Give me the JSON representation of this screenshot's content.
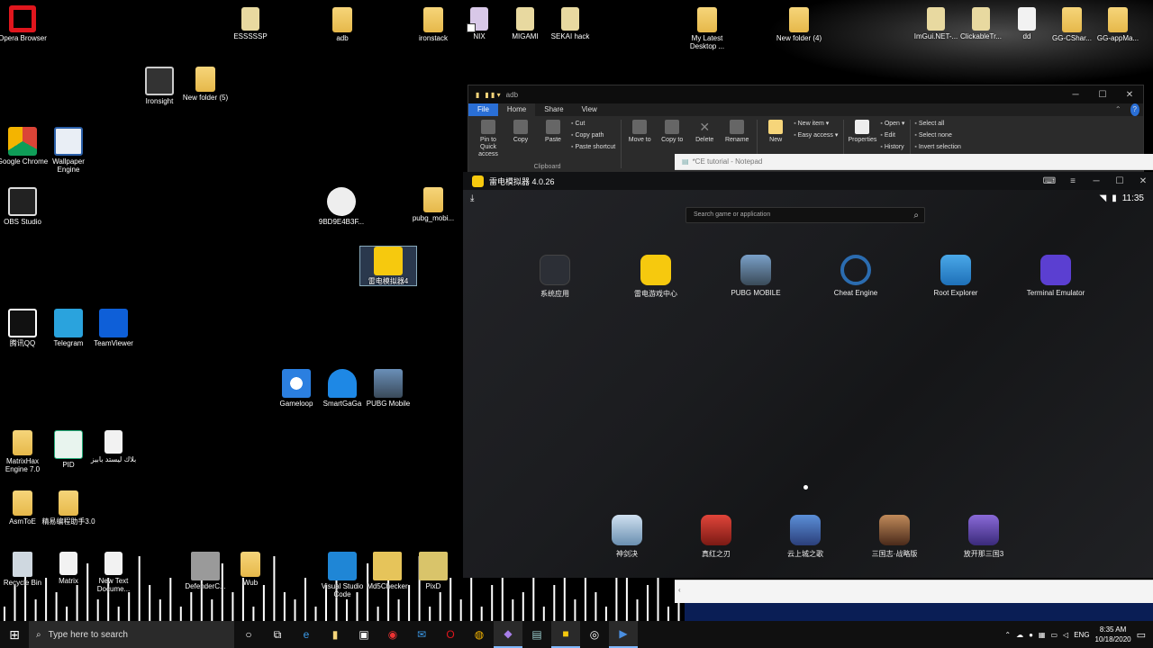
{
  "desktop_icons": [
    {
      "label": "Opera Browser",
      "color": "#e0161d"
    },
    {
      "label": "ESSSSSP"
    },
    {
      "label": "adb"
    },
    {
      "label": "ironstack"
    },
    {
      "label": "NIX"
    },
    {
      "label": "MIGAMI"
    },
    {
      "label": "SEKAI hack"
    },
    {
      "label": "My Latest Desktop ..."
    },
    {
      "label": "New folder (4)"
    },
    {
      "label": "ImGui.NET-..."
    },
    {
      "label": "ClickableTr..."
    },
    {
      "label": "dd"
    },
    {
      "label": "GG-CShar..."
    },
    {
      "label": "GG-appMa..."
    },
    {
      "label": "Ironsight"
    },
    {
      "label": "New folder (5)"
    },
    {
      "label": "Google Chrome"
    },
    {
      "label": "Wallpaper Engine"
    },
    {
      "label": "OBS Studio"
    },
    {
      "label": "9BD9E4B3F..."
    },
    {
      "label": "pubg_mobi..."
    },
    {
      "label": "雷电模拟器4"
    },
    {
      "label": "腾讯QQ"
    },
    {
      "label": "Telegram"
    },
    {
      "label": "TeamViewer"
    },
    {
      "label": "Gameloop"
    },
    {
      "label": "SmartGaGa"
    },
    {
      "label": "PUBG Mobile"
    },
    {
      "label": "MatrixHax Engine 7.0"
    },
    {
      "label": "PID"
    },
    {
      "label": "بلاك ليستد بابيز"
    },
    {
      "label": "AsmToE"
    },
    {
      "label": "精易编程助手3.0"
    },
    {
      "label": "Recycle Bin"
    },
    {
      "label": "Matrix"
    },
    {
      "label": "New Text Docume..."
    },
    {
      "label": "DefenderC..."
    },
    {
      "label": "Wub"
    },
    {
      "label": "Visual Studio Code"
    },
    {
      "label": "Md5Checker"
    },
    {
      "label": "PixD"
    }
  ],
  "explorer": {
    "title": "adb",
    "tabs": [
      "File",
      "Home",
      "Share",
      "View"
    ],
    "clipboard": {
      "pin": "Pin to Quick access",
      "copy": "Copy",
      "paste": "Paste",
      "cut": "Cut",
      "copy_path": "Copy path",
      "paste_shortcut": "Paste shortcut",
      "group": "Clipboard"
    },
    "organize": {
      "move": "Move to",
      "copy": "Copy to",
      "delete": "Delete",
      "rename": "Rename"
    },
    "new": {
      "new_folder": "New",
      "new_item": "New item ▾",
      "easy_access": "Easy access ▾"
    },
    "open": {
      "properties": "Properties",
      "open": "Open ▾",
      "edit": "Edit",
      "history": "History"
    },
    "select": {
      "all": "Select all",
      "none": "Select none",
      "invert": "Invert selection"
    }
  },
  "notepad": {
    "title": "*CE tutorial - Notepad"
  },
  "emulator": {
    "title": "雷电模拟器 4.0.26",
    "time": "11:35",
    "search_placeholder": "Search game or application",
    "apps": [
      {
        "label": "系统应用"
      },
      {
        "label": "雷电游戏中心"
      },
      {
        "label": "PUBG MOBILE"
      },
      {
        "label": "Cheat Engine"
      },
      {
        "label": "Root Explorer"
      },
      {
        "label": "Terminal Emulator"
      }
    ],
    "dock": [
      {
        "label": "神剑决"
      },
      {
        "label": "真红之刃"
      },
      {
        "label": "云上城之歌"
      },
      {
        "label": "三国志·战略版"
      },
      {
        "label": "放开那三国3"
      }
    ]
  },
  "taskbar": {
    "search_placeholder": "Type here to search",
    "language": "ENG",
    "time": "8:35 AM",
    "date": "10/18/2020"
  },
  "viz_bars": [
    0.2,
    0.5,
    0.7,
    0.3,
    0.6,
    0.4,
    0.2,
    0.5,
    0.8,
    0.3,
    0.6,
    0.2,
    0.4,
    0.9,
    0.5,
    0.3,
    0.6,
    0.2,
    0.4,
    0.7,
    0.3,
    0.8,
    0.4,
    0.6,
    0.2,
    0.5,
    0.9,
    0.4,
    0.3,
    0.6,
    0.2,
    0.5,
    0.7,
    0.3,
    0.4,
    0.8,
    0.2,
    0.6,
    0.3,
    0.5,
    0.9,
    0.2,
    0.4,
    0.6,
    0.3,
    0.7,
    0.2,
    0.5,
    0.8,
    0.3,
    0.4,
    0.6,
    0.2,
    0.5,
    0.9,
    0.3,
    0.7,
    0.4,
    0.2,
    0.6,
    0.8,
    0.3,
    0.5,
    0.9,
    0.2,
    0.4
  ]
}
